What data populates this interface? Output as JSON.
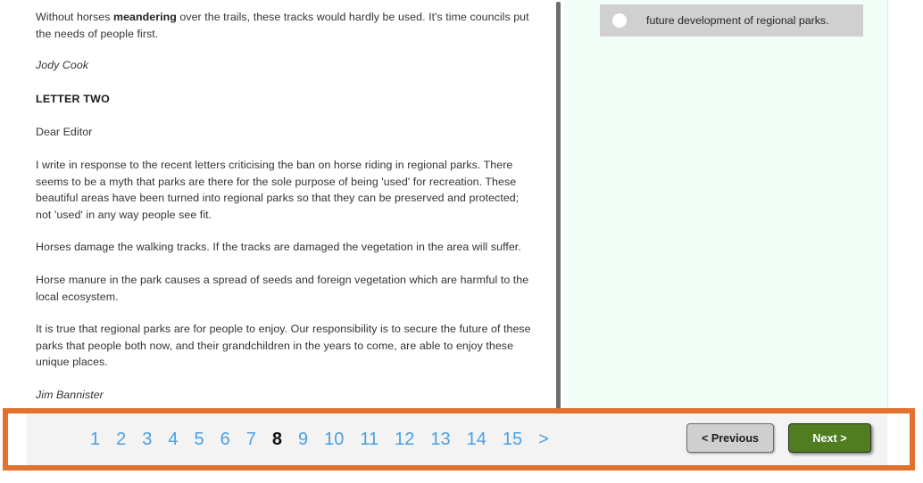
{
  "passage": {
    "paragraphs": [
      {
        "id": "p-intro",
        "style": "body",
        "text_before": "Without horses ",
        "bold": "meandering",
        "text_after": " over the trails, these tracks would hardly be used. It's time councils put the needs of people first."
      },
      {
        "id": "p-sign-1",
        "style": "signature",
        "text": "Jody Cook"
      },
      {
        "id": "p-heading",
        "style": "heading",
        "text": "LETTER TWO"
      },
      {
        "id": "p-salutation",
        "style": "body",
        "text": "Dear Editor"
      },
      {
        "id": "p-1",
        "style": "body",
        "text": "I write in response to the recent letters criticising the ban on horse riding in regional parks. There seems to be a myth that parks are there for the sole purpose of being 'used' for recreation. These beautiful areas have been turned into regional parks so that they can be preserved and protected; not 'used' in any way people see fit."
      },
      {
        "id": "p-2",
        "style": "body",
        "text": "Horses damage the walking tracks. If the tracks are damaged the vegetation in the area will suffer."
      },
      {
        "id": "p-3",
        "style": "body",
        "text": "Horse manure in the park causes a spread of seeds and foreign vegetation which are harmful to the local ecosystem."
      },
      {
        "id": "p-4",
        "style": "body",
        "text": "It is true that regional parks are for people to enjoy. Our responsibility is to secure the future of these parks that people both now, and their grandchildren in the years to come, are able to enjoy these unique places."
      },
      {
        "id": "p-sign-2",
        "style": "signature",
        "text": "Jim Bannister"
      }
    ]
  },
  "question_pane": {
    "background_color": "#f1fdf7",
    "answer_options": [
      {
        "id": "option-future-development",
        "label": "future development of regional parks.",
        "selected": false,
        "radio_icon": "radio-unselected-icon",
        "row_color": "#d0d0d0"
      }
    ]
  },
  "scrollbar": {
    "name": "passage-vertical-scrollbar",
    "thumb_color": "#6e6e6e"
  },
  "navigation": {
    "highlight_color": "#e2712d",
    "bar_color": "#f3f3f3",
    "pagination": {
      "pages": [
        "1",
        "2",
        "3",
        "4",
        "5",
        "6",
        "7",
        "8",
        "9",
        "10",
        "11",
        "12",
        "13",
        "14",
        "15"
      ],
      "current_page": "8",
      "next_arrow_label": ">",
      "link_color": "#4a9fe0"
    },
    "buttons": {
      "previous_label": "< Previous",
      "next_label": "Next >",
      "previous_color": "#cfcfcf",
      "next_color": "#4f7d20"
    }
  }
}
